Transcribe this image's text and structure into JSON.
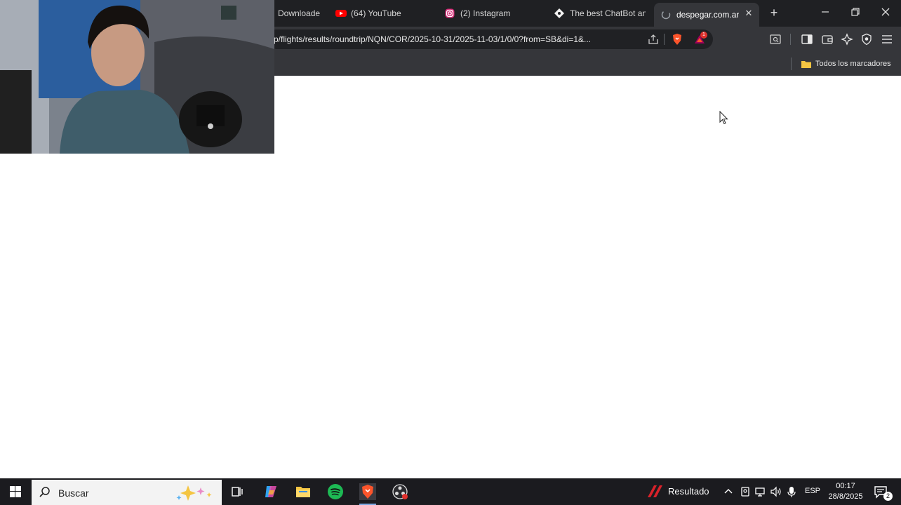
{
  "browser": {
    "tabs": [
      {
        "label": "Downloade",
        "icon": "globe-icon"
      },
      {
        "label": "(64) YouTube",
        "icon": "youtube-icon"
      },
      {
        "label": "(2) Instagram",
        "icon": "instagram-icon"
      },
      {
        "label": "The best ChatBot and",
        "icon": "chatbot-icon"
      },
      {
        "label": "despegar.com.ar",
        "icon": "loading-icon",
        "active": true
      }
    ],
    "new_tab": "+",
    "address_bar": {
      "url": "p/flights/results/roundtrip/NQN/COR/2025-10-31/2025-11-03/1/0/0?from=SB&di=1&..."
    },
    "extension_badge": "1",
    "bookmarks": {
      "all_bookmarks_label": "Todos los marcadores"
    }
  },
  "taskbar": {
    "search_placeholder": "Buscar",
    "weather_label": "Resultado",
    "language": "ESP",
    "time": "00:17",
    "date": "28/8/2025",
    "notifications_count": "2"
  },
  "colors": {
    "tabstrip_bg": "#1f2023",
    "toolbar_bg": "#35363a",
    "taskbar_bg": "#1b1b1f",
    "brave_orange": "#fb542b"
  }
}
